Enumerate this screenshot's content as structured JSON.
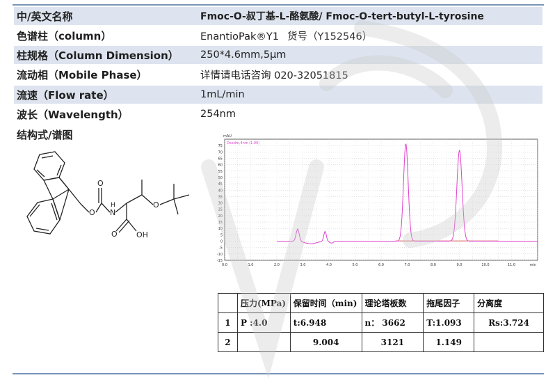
{
  "rows": [
    {
      "label": "中/英文名称",
      "value": "Fmoc-O-叔丁基-L-酪氨酸/ Fmoc-O-tert-butyl-L-tyrosine",
      "hint": ""
    },
    {
      "label": "色谱柱（column）",
      "value": "EnantioPak®Y1",
      "hint": "货号（Y152546）"
    },
    {
      "label": "柱规格（Column Dimension）",
      "value": "250*4.6mm,5µm",
      "hint": ""
    },
    {
      "label": "流动相（Mobile Phase）",
      "value": "详情请电话咨询 020-32051815",
      "hint": ""
    },
    {
      "label": "流速（Flow rate）",
      "value": "1mL/min",
      "hint": ""
    },
    {
      "label": "波长（Wavelength）",
      "value": "254nm",
      "hint": ""
    },
    {
      "label": "结构式/谱图",
      "value": "",
      "hint": ""
    }
  ],
  "structure": {
    "nh_label": "N",
    "h_label": "H",
    "o_label": "O",
    "oh_label": "OH"
  },
  "chart_data": {
    "type": "line",
    "title": "",
    "legend": "Dxxdm,4nm (1.00)",
    "ylabel": "mAU",
    "xlabel": "min",
    "ylim": [
      -15,
      80
    ],
    "xlim": [
      0,
      12
    ],
    "yticks": [
      -15,
      -10,
      -5,
      0,
      5,
      10,
      15,
      20,
      25,
      30,
      35,
      40,
      45,
      50,
      55,
      60,
      65,
      70,
      75
    ],
    "xticks": [
      "0.0",
      "1.0",
      "2.0",
      "3.0",
      "4.0",
      "5.0",
      "6.0",
      "7.0",
      "8.0",
      "9.0",
      "10.0",
      "11.0"
    ],
    "grid": true,
    "line_color": "#e040d0",
    "baseline_color": "#cc2222",
    "peaks": [
      {
        "rt": 2.8,
        "height": 9.5,
        "width": 0.06
      },
      {
        "rt": 3.85,
        "height": 7.5,
        "width": 0.05
      },
      {
        "rt": 6.948,
        "height": 76,
        "width": 0.09
      },
      {
        "rt": 9.004,
        "height": 71,
        "width": 0.1
      }
    ]
  },
  "table": {
    "headers": [
      "",
      "压力(MPa)",
      "保留时间（min)",
      "理论塔板数",
      "拖尾因子",
      "分离度"
    ],
    "rows": [
      [
        "1",
        "P :4.0",
        "t:6.948",
        "n： 3662",
        "T:1.093",
        "Rs:3.724"
      ],
      [
        "2",
        "",
        "9.004",
        "3121",
        "1.149",
        ""
      ]
    ]
  }
}
